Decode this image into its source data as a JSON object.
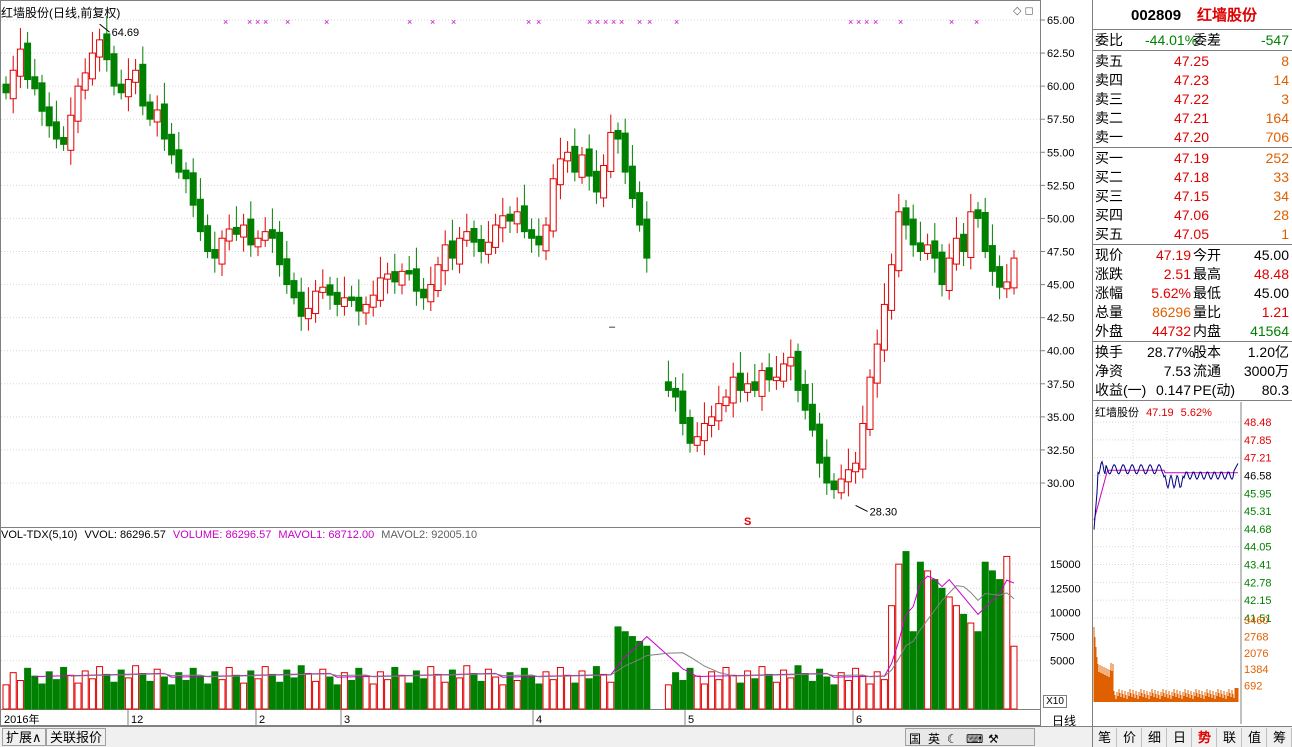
{
  "chart_title": "红墙股份(日线,前复权)",
  "max_label": "64.69",
  "min_label": "28.30",
  "s_marker": "S",
  "dash_marker": "–",
  "y_axis": [
    "65.00",
    "62.50",
    "60.00",
    "57.50",
    "55.00",
    "52.50",
    "50.00",
    "47.50",
    "45.00",
    "42.50",
    "40.00",
    "37.50",
    "35.00",
    "32.50",
    "30.00"
  ],
  "x_axis": {
    "year": "2016年",
    "months": [
      "12",
      "2",
      "3",
      "4",
      "5",
      "6"
    ]
  },
  "period_label": "日线",
  "x10_label": "X10",
  "vol_header": {
    "name": "VOL-TDX(5,10)",
    "vvol": "VVOL: 86296.57",
    "volume": "VOLUME: 86296.57",
    "mavol1": "MAVOL1: 68712.00",
    "mavol2": "MAVOL2: 92005.10"
  },
  "vol_axis": [
    "15000",
    "12500",
    "10000",
    "7500",
    "5000"
  ],
  "chart_data": [
    {
      "type": "candlestick",
      "title": "红墙股份(日线,前复权)",
      "ylim": [
        28.3,
        65
      ],
      "y_ticks": [
        30,
        32.5,
        35,
        37.5,
        40,
        42.5,
        45,
        47.5,
        50,
        52.5,
        55,
        57.5,
        60,
        62.5,
        65
      ],
      "annotations": [
        {
          "label": "64.69",
          "value": 64.69
        },
        {
          "label": "28.30",
          "value": 28.3
        }
      ],
      "legend": ""
    },
    {
      "type": "bar",
      "title": "VOL-TDX(5,10)",
      "series": [
        {
          "name": "VOLUME",
          "last": 86296.57
        },
        {
          "name": "MAVOL1",
          "last": 68712.0
        },
        {
          "name": "MAVOL2",
          "last": 92005.1
        }
      ],
      "y_ticks": [
        5000,
        7500,
        10000,
        12500,
        15000
      ]
    },
    {
      "type": "line",
      "title": "红墙股份 47.19 5.62%",
      "y_ticks": [
        48.48,
        47.85,
        47.21,
        46.58,
        45.95,
        45.31,
        44.68,
        44.05,
        43.41,
        42.78,
        42.15,
        41.51
      ],
      "vol_ticks": [
        3460,
        2768,
        2076,
        1384,
        692
      ]
    }
  ],
  "panel": {
    "code": "002809",
    "name": "红墙股份",
    "weibi_label": "委比",
    "weibi": "-44.01%",
    "weicha_label": "委差",
    "weicha": "-547",
    "asks": [
      {
        "label": "卖五",
        "price": "47.25",
        "vol": "8"
      },
      {
        "label": "卖四",
        "price": "47.23",
        "vol": "14"
      },
      {
        "label": "卖三",
        "price": "47.22",
        "vol": "3"
      },
      {
        "label": "卖二",
        "price": "47.21",
        "vol": "164"
      },
      {
        "label": "卖一",
        "price": "47.20",
        "vol": "706"
      }
    ],
    "bids": [
      {
        "label": "买一",
        "price": "47.19",
        "vol": "252"
      },
      {
        "label": "买二",
        "price": "47.18",
        "vol": "33"
      },
      {
        "label": "买三",
        "price": "47.15",
        "vol": "34"
      },
      {
        "label": "买四",
        "price": "47.06",
        "vol": "28"
      },
      {
        "label": "买五",
        "price": "47.05",
        "vol": "1"
      }
    ],
    "stats": [
      {
        "l1": "现价",
        "v1": "47.19",
        "c1": "red",
        "l2": "今开",
        "v2": "45.00",
        "c2": "blk"
      },
      {
        "l1": "涨跌",
        "v1": "2.51",
        "c1": "red",
        "l2": "最高",
        "v2": "48.48",
        "c2": "red"
      },
      {
        "l1": "涨幅",
        "v1": "5.62%",
        "c1": "red",
        "l2": "最低",
        "v2": "45.00",
        "c2": "blk"
      },
      {
        "l1": "总量",
        "v1": "86296",
        "c1": "orange",
        "l2": "量比",
        "v2": "1.21",
        "c2": "red"
      },
      {
        "l1": "外盘",
        "v1": "44732",
        "c1": "red",
        "l2": "内盘",
        "v2": "41564",
        "c2": "green"
      }
    ],
    "stats2": [
      {
        "l1": "换手",
        "v1": "28.77%",
        "l2": "股本",
        "v2": "1.20亿"
      },
      {
        "l1": "净资",
        "v1": "7.53",
        "l2": "流通",
        "v2": "3000万"
      },
      {
        "l1": "收益(一)",
        "v1": "0.147",
        "l2": "PE(动)",
        "v2": "80.3"
      }
    ],
    "mini_title": "红墙股份",
    "mini_price": "47.19",
    "mini_pct": "5.62%"
  },
  "bottom_tabs": [
    "扩展∧",
    "关联报价"
  ],
  "tools": [
    "国",
    "英",
    "☾",
    "⌨",
    "⚒"
  ],
  "right_tabs": [
    "笔",
    "价",
    "细",
    "日",
    "势",
    "联",
    "值",
    "筹"
  ],
  "active_right_tab": "势",
  "colors": {
    "up": "#e00000",
    "down": "#008000",
    "ma1": "#c800c8",
    "ma2": "#808080",
    "grid": "#d8d8d8",
    "intraday": "#000080",
    "avg": "#c800c8",
    "minivol": "#e06000"
  }
}
